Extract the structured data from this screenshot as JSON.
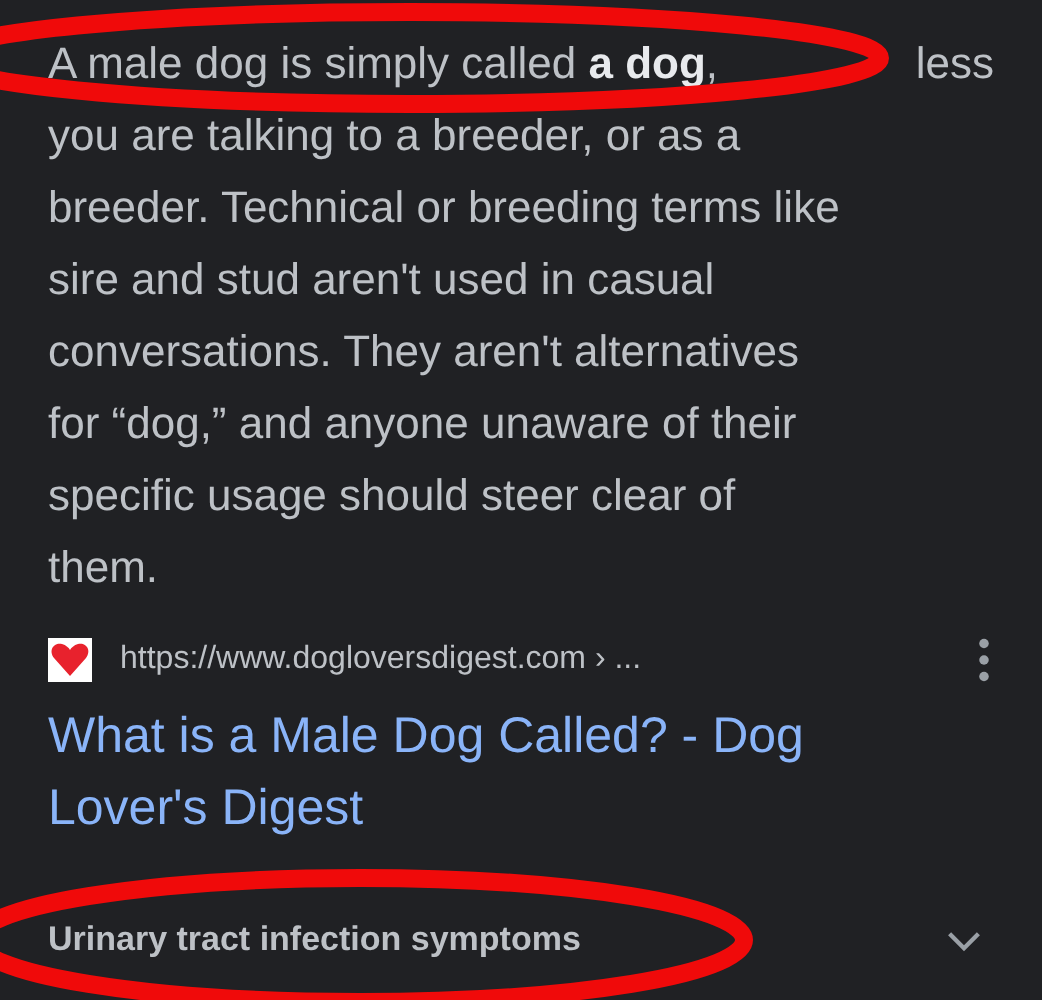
{
  "snippet": {
    "lines": [
      [
        "A male dog is simply called **a dog**,",
        "less"
      ],
      [
        "you are talking to a breeder, or as a"
      ],
      [
        "breeder. Technical or breeding terms like"
      ],
      [
        "sire and stud aren't used in casual"
      ],
      [
        "conversations. They aren't alternatives"
      ],
      [
        "for “dog,” and anyone unaware of their"
      ],
      [
        "specific usage should steer clear of"
      ],
      [
        "them."
      ]
    ]
  },
  "result": {
    "url": "https://www.dogloversdigest.com › ...",
    "title_lines": [
      "What is a Male Dog Called? - Dog",
      "Lover's Digest"
    ]
  },
  "related": {
    "label": "Urinary tract infection symptoms",
    "expanded": false
  }
}
